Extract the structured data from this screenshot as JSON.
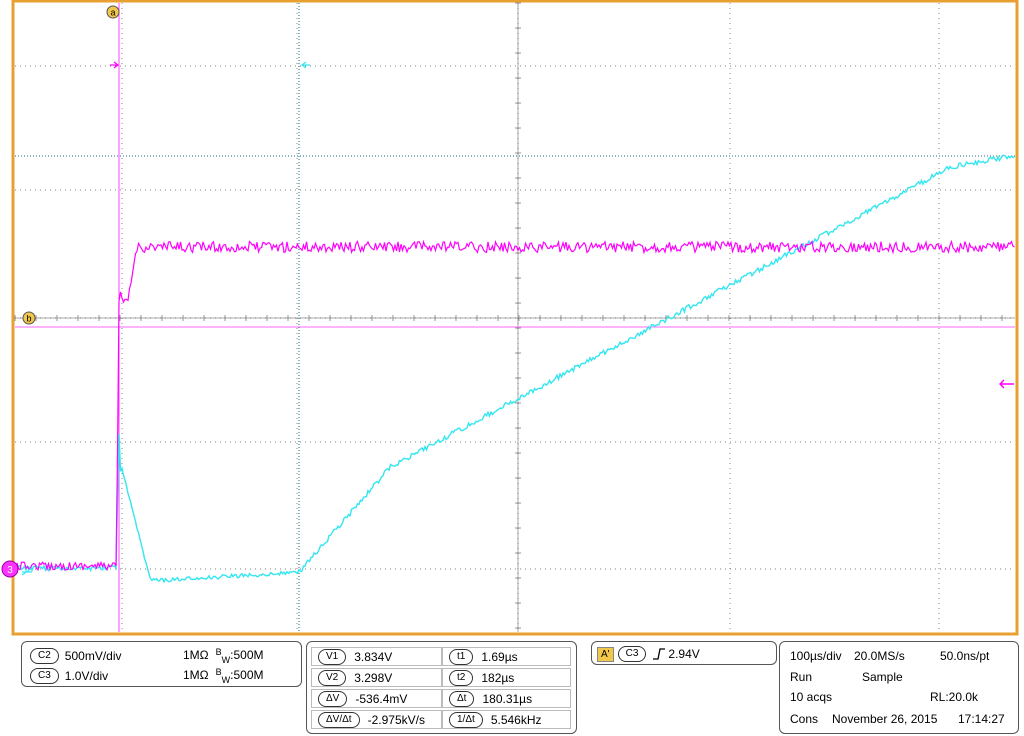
{
  "colors": {
    "frame": "#e8a033",
    "grid": "#555555",
    "ch2": "#ff00ff",
    "ch3": "#33e6f0",
    "cursor_a": "#ff00ff",
    "cursor_b_line": "#ff66ff",
    "cursor_vertical_b": "#1a7fa0",
    "marker_a_fill": "#f2c84b"
  },
  "markers": {
    "a": "a",
    "b": "b",
    "ch3": "3"
  },
  "channels": [
    {
      "name": "C2",
      "scale": "500mV/div",
      "impedance": "1MΩ",
      "bw_prefix": "B",
      "bw_sub": "W",
      "bw": ":500M"
    },
    {
      "name": "C3",
      "scale": "1.0V/div",
      "impedance": "1MΩ",
      "bw_prefix": "B",
      "bw_sub": "W",
      "bw": ":500M"
    }
  ],
  "cursors": [
    {
      "label": "V1",
      "value": "3.834V",
      "label2": "t1",
      "value2": "1.69µs"
    },
    {
      "label": "V2",
      "value": "3.298V",
      "label2": "t2",
      "value2": "182µs"
    },
    {
      "label": "ΔV",
      "value": "-536.4mV",
      "label2": "Δt",
      "value2": "180.31µs"
    },
    {
      "label": "ΔV/Δt",
      "value": "-2.975kV/s",
      "label2": "1/Δt",
      "value2": "5.546kHz"
    }
  ],
  "trigger": {
    "mode": "A'",
    "source": "C3",
    "slope_icon": "rising-edge-icon",
    "level": "2.94V"
  },
  "acquisition": {
    "timebase": "100µs/div",
    "sample_rate": "20.0MS/s",
    "resolution": "50.0ns/pt",
    "state": "Run",
    "mode": "Sample",
    "acqs": "10 acqs",
    "record_length": "RL:20.0k",
    "cons": "Cons",
    "date": "November 26, 2015",
    "time": "17:14:27"
  }
}
